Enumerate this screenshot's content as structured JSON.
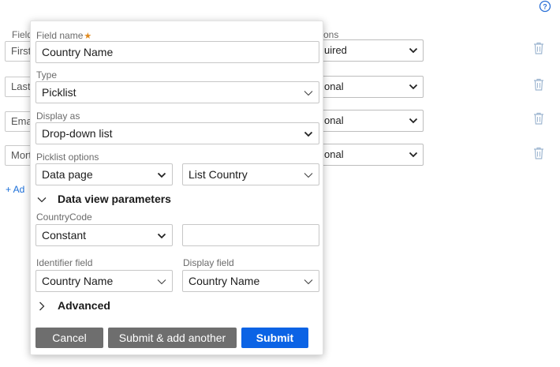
{
  "background": {
    "column_labels": {
      "field": "Field",
      "options": "ons"
    },
    "rows": [
      {
        "field_text": "First",
        "option": "uired"
      },
      {
        "field_text": "Last",
        "option": "onal"
      },
      {
        "field_text": "Ema",
        "option": "onal"
      },
      {
        "field_text": "Mort",
        "option": "onal"
      }
    ],
    "add_link": "+ Ad"
  },
  "modal": {
    "field_name": {
      "label": "Field name",
      "required_mark": "★",
      "value": "Country Name"
    },
    "type": {
      "label": "Type",
      "value": "Picklist"
    },
    "display_as": {
      "label": "Display as",
      "value": "Drop-down list"
    },
    "picklist_options": {
      "label": "Picklist options",
      "source": "Data page",
      "source_name": "List Country"
    },
    "data_view_parameters": {
      "heading": "Data view parameters",
      "param_label": "CountryCode",
      "param_mode": "Constant",
      "param_value": ""
    },
    "identifier_field": {
      "label": "Identifier field",
      "value": "Country Name"
    },
    "display_field": {
      "label": "Display field",
      "value": "Country Name"
    },
    "advanced": {
      "heading": "Advanced"
    },
    "buttons": {
      "cancel": "Cancel",
      "submit_add_another": "Submit & add another",
      "submit": "Submit"
    }
  },
  "colors": {
    "primary": "#0b63e5",
    "secondary_button": "#6e6e6e",
    "required": "#e08a1e",
    "link": "#1a6ed8",
    "trash": "#9fb7d1"
  },
  "icons": [
    "help-icon",
    "trash-icon",
    "chevron-down-icon",
    "chevron-right-icon"
  ]
}
